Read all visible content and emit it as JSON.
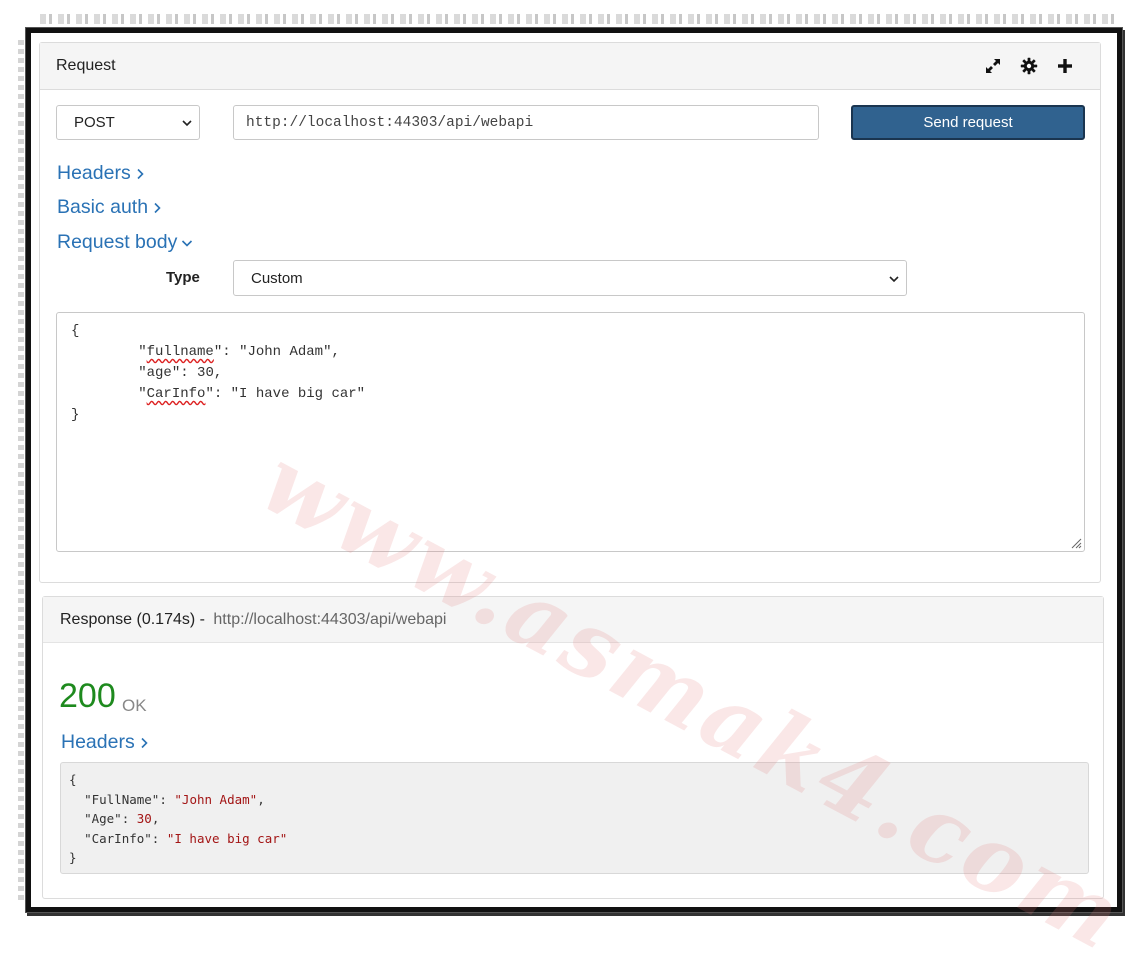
{
  "request": {
    "title": "Request",
    "icons": [
      "expand-icon",
      "gear-icon",
      "plus-icon"
    ],
    "method": "POST",
    "url": "http://localhost:44303/api/webapi",
    "send_label": "Send request",
    "headers_link": "Headers",
    "basic_auth_link": "Basic auth",
    "request_body_link": "Request body",
    "type_label": "Type",
    "type_value": "Custom",
    "body_lines": {
      "open": "{",
      "fullname_key": "fullname",
      "fullname_val": "\"John Adam\",",
      "age_key": "\"age\"",
      "age_val": "30,",
      "carinfo_key": "CarInfo",
      "carinfo_val": "\"I have big car\"",
      "close": "}"
    }
  },
  "response": {
    "title": "Response (0.174s)",
    "separator": " - ",
    "url": "http://localhost:44303/api/webapi",
    "status_code": "200",
    "status_text": "OK",
    "headers_link": "Headers",
    "json": {
      "open": "{",
      "fullname_key": "\"FullName\"",
      "fullname_val": "\"John Adam\"",
      "age_key": "\"Age\"",
      "age_val": "30",
      "carinfo_key": "\"CarInfo\"",
      "carinfo_val": "\"I have big car\"",
      "close": "}"
    }
  },
  "watermark": "www.asmak4.com",
  "colors": {
    "accent": "#2a72b5",
    "send_button": "#30628f",
    "status_ok": "#1e8a1e",
    "json_string": "#a31515"
  }
}
